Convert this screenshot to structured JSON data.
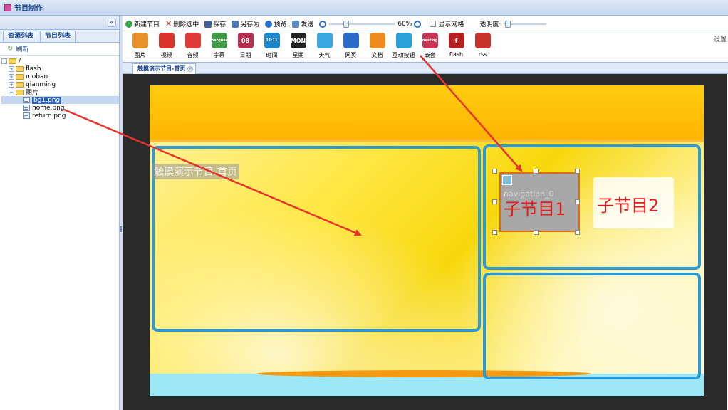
{
  "window": {
    "title": "节目制作"
  },
  "left_panel": {
    "collapse_glyph": "«",
    "tabs": [
      "资源列表",
      "节目列表"
    ],
    "refresh_label": "刷新",
    "tree": {
      "root": "/",
      "folders": [
        "flash",
        "moban",
        "qianming",
        "图片"
      ],
      "files": [
        "bg1.png",
        "home.png",
        "return.png"
      ],
      "selected_file": "bg1.png"
    }
  },
  "toolbar": {
    "new_label": "新建节目",
    "delete_label": "删除选中",
    "save_label": "保存",
    "saveas_label": "另存为",
    "preview_label": "预览",
    "send_label": "发送",
    "zoom_value": "60%",
    "grid_label": "显示网格",
    "opacity_label": "透明度:"
  },
  "widgets": {
    "items": [
      {
        "label": "图片",
        "icon": "image-icon",
        "color": "#e8912b"
      },
      {
        "label": "视频",
        "icon": "video-icon",
        "color": "#d9342b"
      },
      {
        "label": "音频",
        "icon": "music-icon",
        "color": "#e03a3a"
      },
      {
        "label": "字幕",
        "icon": "marquee-icon",
        "color": "#3f9a46",
        "text": "marquee"
      },
      {
        "label": "日期",
        "icon": "calendar-icon",
        "color": "#b23050",
        "text": "08"
      },
      {
        "label": "时间",
        "icon": "clock-icon",
        "color": "#1a86c9",
        "text": "11:11"
      },
      {
        "label": "星期",
        "icon": "weekday-icon",
        "color": "#222222",
        "text": "MON"
      },
      {
        "label": "天气",
        "icon": "weather-icon",
        "color": "#3aa7e0"
      },
      {
        "label": "网页",
        "icon": "webpage-icon",
        "color": "#2a6cc5"
      },
      {
        "label": "文档",
        "icon": "document-icon",
        "color": "#ef8a1e"
      },
      {
        "label": "互动按钮",
        "icon": "touch-button-icon",
        "color": "#2a9fd8"
      },
      {
        "label": "嵌套",
        "icon": "nested-icon",
        "color": "#c83454",
        "text": "nesting"
      },
      {
        "label": "flash",
        "icon": "flash-icon",
        "color": "#b41f1f",
        "text": "f"
      },
      {
        "label": "rss",
        "icon": "rss-icon",
        "color": "#c8332c"
      }
    ],
    "settings_label": "设置"
  },
  "doc_tab": {
    "label": "触摸演示节目-首页"
  },
  "canvas": {
    "page_label": "触摸演示节目-首页",
    "button1_caption": "子节目1",
    "button1_overlay": "navigation_0",
    "button2_caption": "子节目2"
  },
  "colors": {
    "header_bg": "#dfe8f6",
    "accent": "#15428b",
    "region_border": "#2e9ad5",
    "annotation_arrow": "#e8322d"
  }
}
